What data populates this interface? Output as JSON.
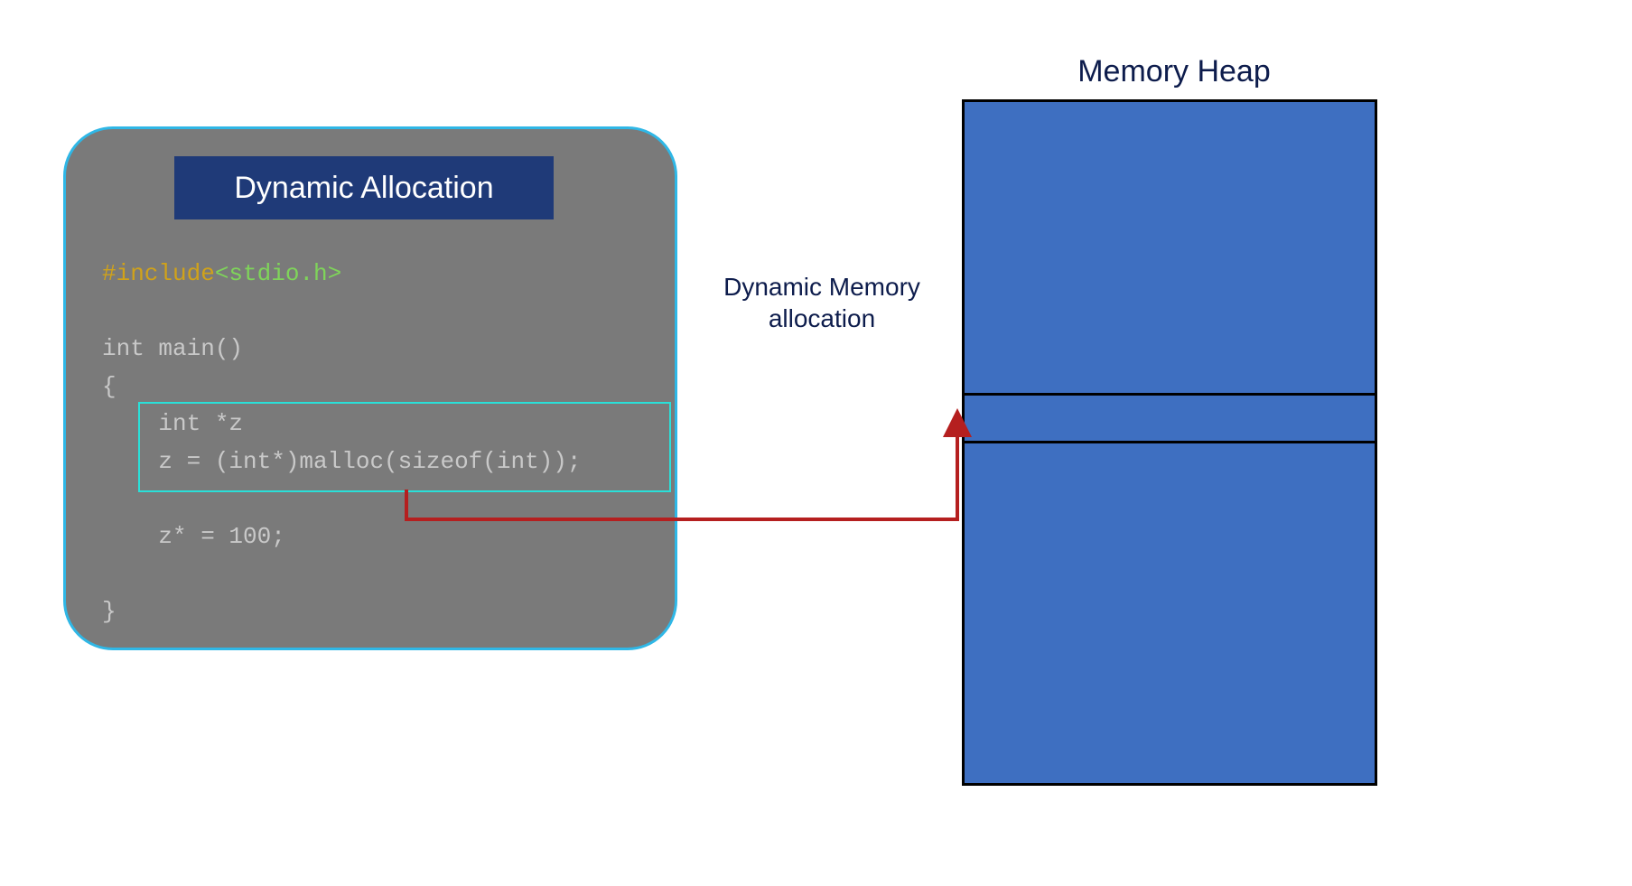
{
  "panel": {
    "title": "Dynamic Allocation",
    "code": {
      "include_kw": "#include",
      "include_header": "<stdio.h>",
      "line_main": "int main()",
      "line_open": "{",
      "line_decl": "    int *z",
      "line_malloc": "    z = (int*)malloc(sizeof(int));",
      "line_assign": "    z* = 100;",
      "line_close": "}"
    }
  },
  "labels": {
    "heap_title": "Memory Heap",
    "arrow_label": "Dynamic Memory allocation"
  },
  "colors": {
    "panel_bg": "#7a7a7a",
    "panel_border": "#2fb7e6",
    "title_bg": "#1f3a78",
    "highlight_border": "#29e0d9",
    "heap_fill": "#3e6fc1",
    "arrow": "#b51f1f"
  }
}
